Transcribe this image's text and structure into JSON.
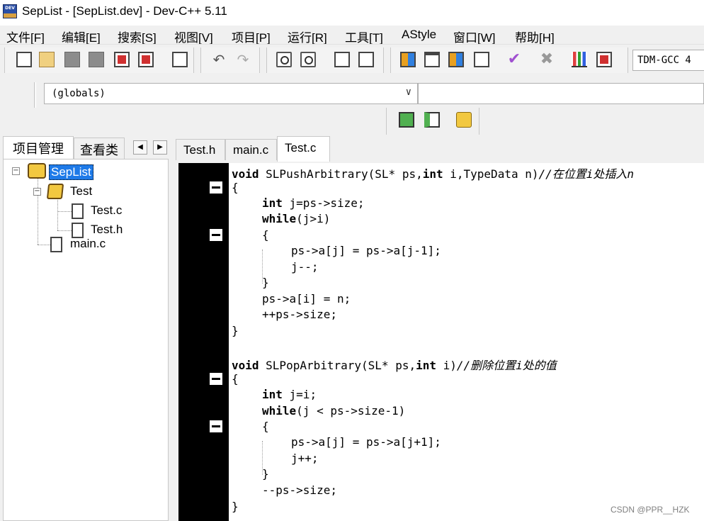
{
  "window": {
    "title": "SepList - [SepList.dev] - Dev-C++ 5.11",
    "icon": "dev-cpp-app-icon",
    "icon_text": "DEV"
  },
  "menubar": {
    "items": [
      "文件[F]",
      "编辑[E]",
      "搜索[S]",
      "视图[V]",
      "项目[P]",
      "运行[R]",
      "工具[T]",
      "AStyle",
      "窗口[W]",
      "帮助[H]"
    ]
  },
  "toolbar": {
    "icons": [
      "new-file-icon",
      "open-file-icon",
      "save-icon",
      "save-all-icon",
      "close-icon",
      "close-all-icon",
      "print-icon",
      "undo-icon",
      "redo-icon",
      "find-icon",
      "replace-icon",
      "indent-icon",
      "unindent-icon",
      "tile-icon",
      "window-icon",
      "layout-icon",
      "grid-icon",
      "check-syntax-icon",
      "stop-icon",
      "chart-icon",
      "profile-delete-icon"
    ],
    "compiler": "TDM-GCC 4"
  },
  "scope_bar": {
    "scope_value": "(globals)",
    "function_value": ""
  },
  "panel_tabs": {
    "project": "项目管理",
    "classes": "查看类"
  },
  "tree": {
    "project": "SepList",
    "folder": "Test",
    "files": [
      "Test.c",
      "Test.h",
      "main.c"
    ]
  },
  "editor_tabs": [
    "Test.h",
    "main.c",
    "Test.c"
  ],
  "active_tab": "Test.c",
  "code": {
    "fn1_sig_kw": "void",
    "fn1_sig_name": " SLPushArbitrary(SL* ps,",
    "fn1_sig_kw2": "int",
    "fn1_sig_rest": " i,TypeData n)",
    "fn1_comment": "//在位置i处插入n",
    "open_brace": "{",
    "close_brace": "}",
    "fn1_l1_kw": "int",
    "fn1_l1_rest": " j=ps->size;",
    "fn1_l2_kw": "while",
    "fn1_l2_rest": "(j>i)",
    "fn1_l3": "ps->a[j] = ps->a[j-1];",
    "fn1_l4": "j--;",
    "fn1_l5": "ps->a[i] = n;",
    "fn1_l6": "++ps->size;",
    "fn2_sig_kw": "void",
    "fn2_sig_name": " SLPopArbitrary(SL* ps,",
    "fn2_sig_kw2": "int",
    "fn2_sig_rest": " i)",
    "fn2_comment": "//删除位置i处的值",
    "fn2_l1_kw": "int",
    "fn2_l1_rest": " j=i;",
    "fn2_l2_kw": "while",
    "fn2_l2_rest": "(j < ps->size-1)",
    "fn2_l3": "ps->a[j] = ps->a[j+1];",
    "fn2_l4": "j++;",
    "fn2_l5": "--ps->size;"
  },
  "watermark": "CSDN @PPR__HZK"
}
